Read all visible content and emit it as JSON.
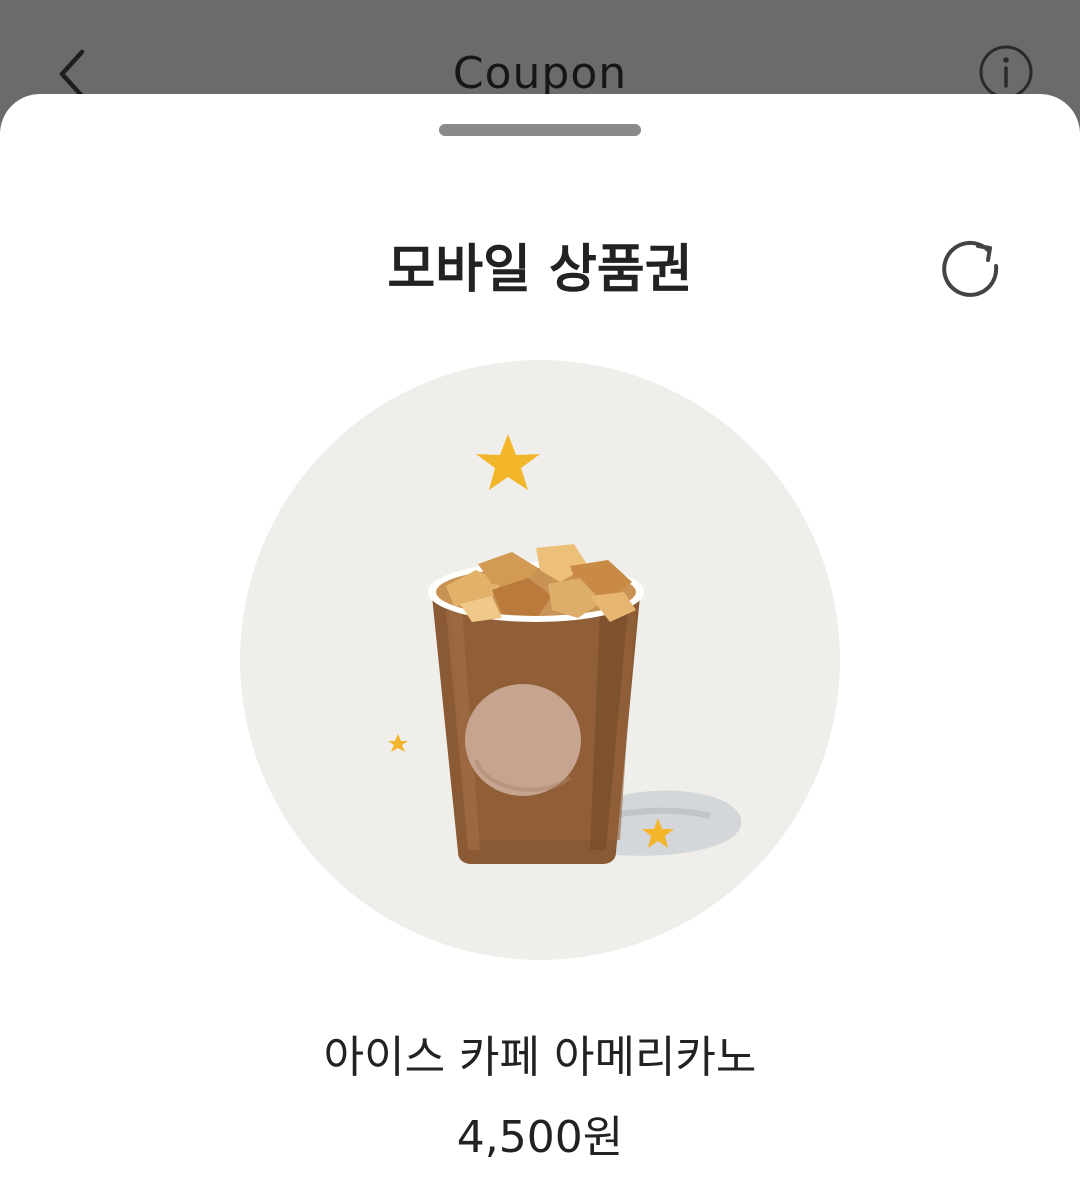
{
  "header": {
    "title": "Coupon",
    "back_icon": "chevron-left-icon",
    "info_icon": "info-icon"
  },
  "sheet": {
    "title": "모바일 상품권",
    "refresh_icon": "refresh-icon"
  },
  "product": {
    "image": "iced-coffee-cup-illustration",
    "name": "아이스 카페 아메리카노",
    "price": "4,500원"
  },
  "colors": {
    "overlay": "#6b6b6b",
    "sheet_bg": "#ffffff",
    "circle_bg": "#efeeea",
    "star": "#f3b52a",
    "coffee": "#8a5a34"
  }
}
